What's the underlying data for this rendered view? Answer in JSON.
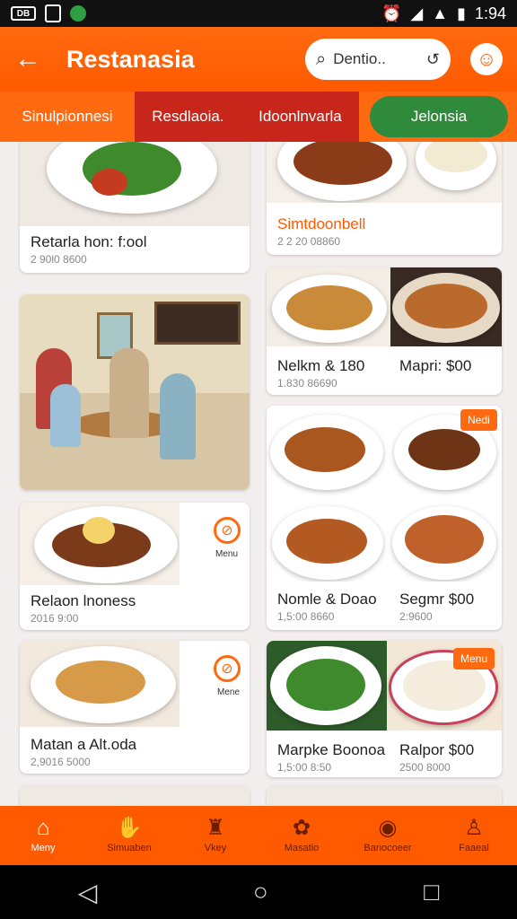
{
  "status_bar": {
    "left_badge": "DB",
    "time": "1:94"
  },
  "app_bar": {
    "title": "Restanasia",
    "search_text": "Dentio.."
  },
  "tabs": [
    {
      "label": "Sinulpionnesi"
    },
    {
      "label": "Resdlaoia."
    },
    {
      "label": "Idoonlnvarla"
    },
    {
      "label": "Jelonsia"
    }
  ],
  "cards": {
    "c1": {
      "title": "Retarla hon: f:ool",
      "sub": "2 90l0 8600"
    },
    "c3": {
      "title": "Relaon lnoness",
      "sub": "2016 9:00",
      "icon_label": "Menu"
    },
    "c4": {
      "title": "Matan a Alt.oda",
      "sub": "2,9016 5000",
      "icon_label": "Mene"
    },
    "r1": {
      "title": "Simtdoonbell",
      "sub": "2 2 20 08860"
    },
    "r2": {
      "left_title": "Nelkm & 180",
      "right_title": "Mapri: $00",
      "sub": "1.830 86690"
    },
    "r3": {
      "badge": "Nedi",
      "left_title": "Nomle & Doao",
      "right_title": "Segmr $00",
      "left_sub": "1,5:00 8660",
      "right_sub": "2:9600"
    },
    "r4": {
      "badge": "Menu",
      "left_title": "Marpke Boonoa",
      "right_title": "Ralpor $00",
      "left_sub": "1,5:00 8:50",
      "right_sub": "2500 8000"
    }
  },
  "bottom_nav": [
    {
      "label": "Meny",
      "icon": "home-icon",
      "active": true
    },
    {
      "label": "Simuaben",
      "icon": "hand-icon",
      "active": false
    },
    {
      "label": "Vkey",
      "icon": "bag-icon",
      "active": false
    },
    {
      "label": "Masatio",
      "icon": "gift-icon",
      "active": false
    },
    {
      "label": "Banocoeer",
      "icon": "badge-icon",
      "active": false
    },
    {
      "label": "Faaeal",
      "icon": "user-icon",
      "active": false
    }
  ],
  "colors": {
    "primary": "#ff5a00",
    "tab_active": "#c8261a",
    "tab_green": "#2f8a3b"
  }
}
